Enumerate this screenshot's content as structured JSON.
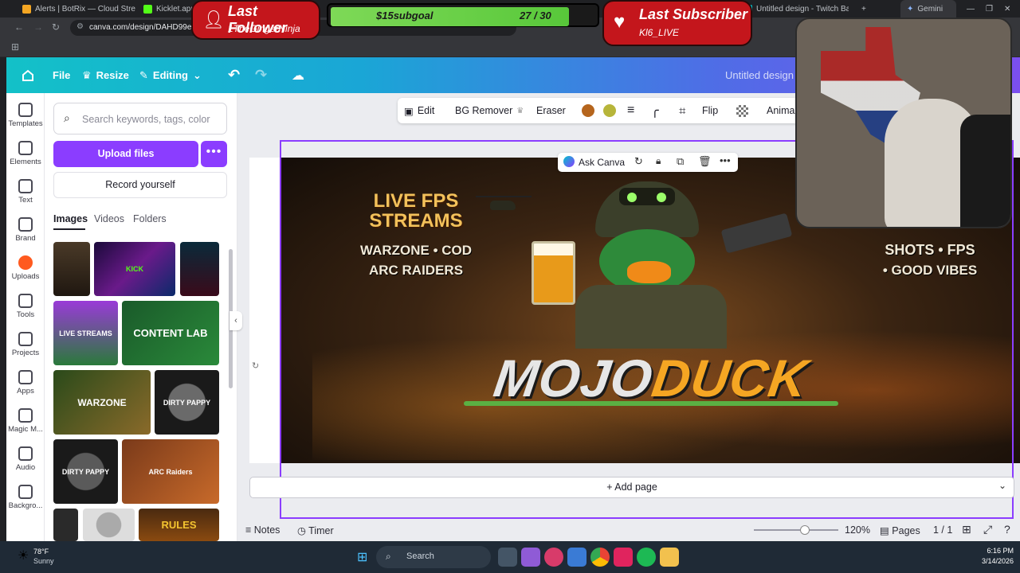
{
  "browser": {
    "tabs": [
      "Alerts | BotRix — Cloud Stre",
      "Kicklet.app - Ki",
      "Untitled design - Twitch Banr",
      "Gemini"
    ],
    "url": "canva.com/design/DAHD99exvi",
    "new_tab": "+"
  },
  "overlay": {
    "follower_title": "Last Follower",
    "follower_name": "1TheGingerNinja",
    "goal_text": "$15subgoal",
    "goal_count": "27 / 30",
    "goal_fraction": 0.9,
    "subscriber_title": "Last Subscriber",
    "subscriber_name": "Kl6_LIVE"
  },
  "canva_header": {
    "file": "File",
    "resize": "Resize",
    "editing": "Editing",
    "design_title": "Untitled design"
  },
  "rail": [
    {
      "label": "Templates",
      "icon": "templates-icon"
    },
    {
      "label": "Elements",
      "icon": "elements-icon"
    },
    {
      "label": "Text",
      "icon": "text-icon"
    },
    {
      "label": "Brand",
      "icon": "brand-icon"
    },
    {
      "label": "Uploads",
      "icon": "uploads-icon"
    },
    {
      "label": "Tools",
      "icon": "tools-icon"
    },
    {
      "label": "Projects",
      "icon": "projects-icon"
    },
    {
      "label": "Apps",
      "icon": "apps-icon"
    },
    {
      "label": "Magic M...",
      "icon": "magic-media-icon"
    },
    {
      "label": "Audio",
      "icon": "audio-icon"
    },
    {
      "label": "Backgro...",
      "icon": "background-icon"
    }
  ],
  "panel": {
    "search_placeholder": "Search keywords, tags, color",
    "upload_label": "Upload files",
    "more_label": "•••",
    "record_label": "Record yourself",
    "tabs": [
      "Images",
      "Videos",
      "Folders"
    ],
    "thumbs": [
      "KICK",
      "LIVE STREAMS",
      "",
      "",
      "CONTENT LAB",
      "WARZONE",
      "DIRTY PAPPY",
      "DIRTY PAPPY",
      "ARC Raiders",
      "",
      "",
      "RULES"
    ]
  },
  "context_bar": {
    "edit": "Edit",
    "bg_remover": "BG Remover",
    "eraser": "Eraser",
    "swatches": [
      "#b5651d",
      "#b7b53a"
    ],
    "flip": "Flip",
    "animate": "Anima"
  },
  "ask_bar": {
    "label": "Ask Canva"
  },
  "banner": {
    "left_line1": "LIVE FPS",
    "left_line2": "STREAMS",
    "left_line3": "WARZONE • COD",
    "left_line4": "ARC RAIDERS",
    "right_line1": "SHOTS • FPS",
    "right_line2": "• GOOD VIBES",
    "logo_a": "MOJO",
    "logo_b": "DUCK"
  },
  "add_page": "+ Add page",
  "footer": {
    "notes": "Notes",
    "timer": "Timer",
    "zoom": "120%",
    "zoom_fraction": 0.6,
    "pages": "Pages",
    "page_count": "1 / 1"
  },
  "taskbar": {
    "weather_temp": "78°F",
    "weather_desc": "Sunny",
    "search": "Search",
    "time": "6:16 PM",
    "date": "3/14/2026"
  }
}
